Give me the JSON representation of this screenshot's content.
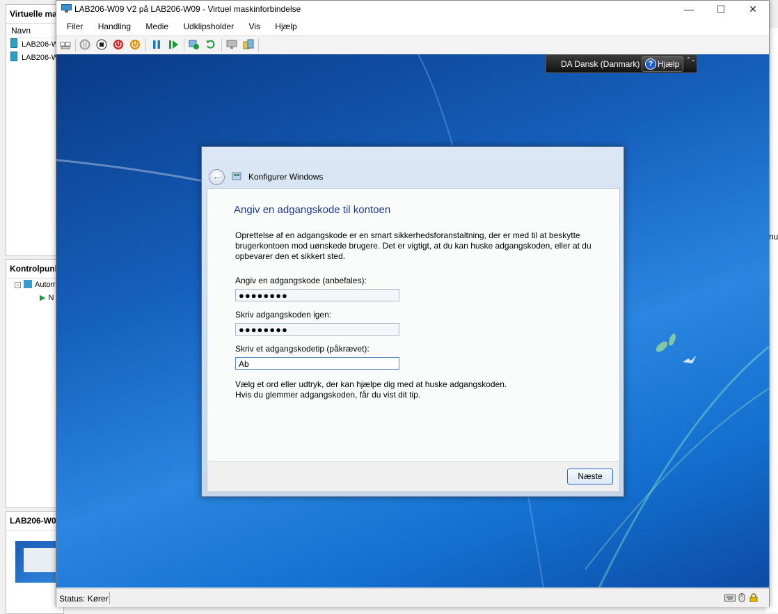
{
  "background_app": {
    "vm_panel": {
      "header": "Virtuelle ma",
      "column": "Navn",
      "rows": [
        "LAB206-W",
        "LAB206-W"
      ]
    },
    "checkpoint_panel": {
      "header": "Kontrolpunk",
      "items": [
        "Autom",
        "N"
      ]
    },
    "details_panel": {
      "header": "LAB206-W0"
    },
    "right_edge_text": "nu."
  },
  "window": {
    "title": "LAB206-W09 V2 på LAB206-W09 - Virtuel maskinforbindelse",
    "minimize": "—",
    "maximize": "☐",
    "close": "✕"
  },
  "menu": {
    "items": [
      "Filer",
      "Handling",
      "Medie",
      "Udklipsholder",
      "Vis",
      "Hjælp"
    ]
  },
  "toolbar": {
    "icons": [
      "ctrl-alt-del-icon",
      "power-icon",
      "stop-icon",
      "shutdown-icon",
      "save-state-icon",
      "pause-icon",
      "resume-icon",
      "checkpoint-icon",
      "revert-icon",
      "basic-session-icon",
      "enhanced-session-icon"
    ],
    "colors": {
      "red": "#d02020",
      "orange": "#e08a00",
      "blue": "#1e78c8",
      "green": "#1a9a3a"
    }
  },
  "language_bar": {
    "language": "DA Dansk (Danmark)",
    "help_label": "Hjælp",
    "help_symbol": "?",
    "dropdown": "⌃⌄"
  },
  "dialog": {
    "title": "Konfigurer Windows",
    "heading": "Angiv en adgangskode til kontoen",
    "description_lines": [
      "Oprettelse af en adgangskode er en smart sikkerhedsforanstaltning, der er med til at beskytte",
      "brugerkontoen mod uønskede brugere. Det er vigtigt, at du kan huske adgangskoden, eller at du",
      "opbevarer den et sikkert sted."
    ],
    "password_label": "Angiv en adgangskode (anbefales):",
    "password_value": "●●●●●●●●",
    "confirm_label": "Skriv adgangskoden igen:",
    "confirm_value": "●●●●●●●●",
    "hint_label": "Skriv et adgangskodetip (påkrævet):",
    "hint_value": "Ab",
    "hint_help_lines": [
      "Vælg et ord eller udtryk, der kan hjælpe dig med at huske adgangskoden.",
      "Hvis du glemmer adgangskoden, får du vist dit tip."
    ],
    "next_button": "Næste",
    "accent_color": "#1f3b8f"
  },
  "statusbar": {
    "status": "Status: Kører"
  }
}
